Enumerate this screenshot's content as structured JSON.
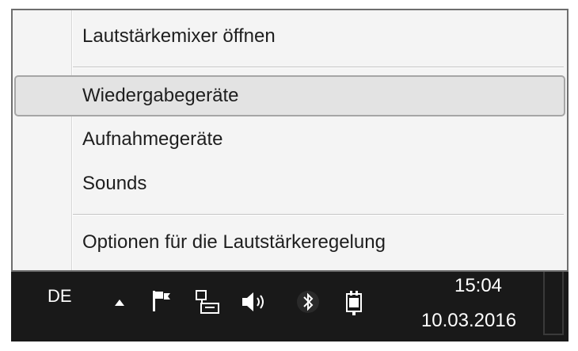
{
  "menu": {
    "items": [
      {
        "label": "Lautstärkemixer öffnen"
      },
      {
        "label": "Wiedergabegeräte"
      },
      {
        "label": "Aufnahmegeräte"
      },
      {
        "label": "Sounds"
      },
      {
        "label": "Optionen für die Lautstärkeregelung"
      }
    ]
  },
  "taskbar": {
    "language": "DE",
    "tray_icons": [
      "chevron-up-icon",
      "flag-icon",
      "network-icon",
      "speaker-icon",
      "bluetooth-icon",
      "power-plug-icon"
    ],
    "clock": {
      "time": "15:04",
      "date": "10.03.2016"
    }
  },
  "colors": {
    "taskbar_bg": "#191919",
    "menu_bg": "#f4f4f4",
    "highlight_bg": "#e3e3e3"
  }
}
